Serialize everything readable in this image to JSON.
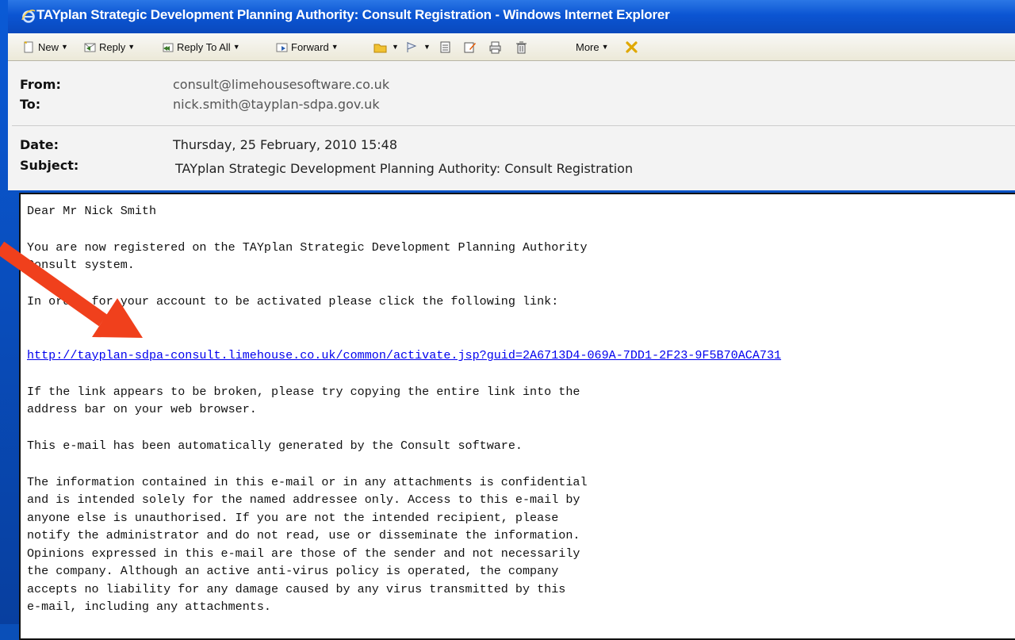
{
  "window": {
    "title": "TAYplan Strategic Development Planning Authority: Consult Registration - Windows Internet Explorer"
  },
  "toolbar": {
    "new_label": "New",
    "reply_label": "Reply",
    "reply_all_label": "Reply To All",
    "forward_label": "Forward",
    "more_label": "More"
  },
  "header": {
    "from_label": "From:",
    "from_value": "consult@limehousesoftware.co.uk",
    "to_label": "To:",
    "to_value": "nick.smith@tayplan-sdpa.gov.uk",
    "date_label": "Date:",
    "date_value": "Thursday, 25 February, 2010 15:48",
    "subject_label": "Subject:",
    "subject_value": "TAYplan Strategic Development Planning Authority: Consult Registration"
  },
  "message": {
    "greeting": "Dear Mr Nick Smith",
    "para1_line1": "You are now registered on the TAYplan Strategic Development Planning Authority",
    "para1_line2": "Consult system.",
    "para2": "In order for your account to be activated please click the following link:",
    "activation_link": "http://tayplan-sdpa-consult.limehouse.co.uk/common/activate.jsp?guid=2A6713D4-069A-7DD1-2F23-9F5B70ACA731",
    "para3_line1": "If the link appears to be broken, please try copying the entire link into the",
    "para3_line2": "address bar on your web browser.",
    "para4": "This e-mail has been automatically generated by the Consult software.",
    "disclaimer": [
      "The information contained in this e-mail or in any attachments is confidential",
      "and is intended solely for the named addressee only. Access to this e-mail by",
      "anyone else is unauthorised. If you are not the intended recipient, please",
      "notify the administrator and do not read, use or disseminate the information.",
      "Opinions expressed in this e-mail are those of the sender and not necessarily",
      "the company. Although an active anti-virus policy is operated, the company",
      "accepts no liability for any damage caused by any virus transmitted by this",
      "e-mail, including any attachments."
    ]
  },
  "colors": {
    "titlebar": "#0b55d3",
    "link": "#0000ee",
    "arrow": "#f0401c"
  }
}
